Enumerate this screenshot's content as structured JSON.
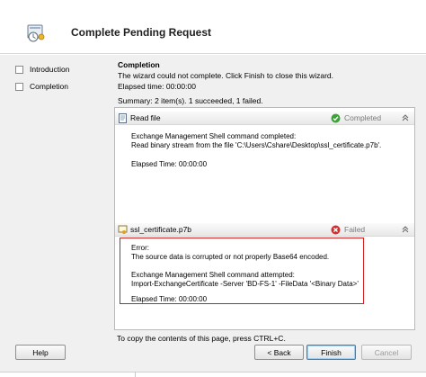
{
  "header": {
    "title": "Complete Pending Request"
  },
  "nav": {
    "items": [
      {
        "label": "Introduction"
      },
      {
        "label": "Completion"
      }
    ]
  },
  "completion": {
    "title": "Completion",
    "status": "The wizard could not complete. Click Finish to close this wizard.",
    "elapsed": "Elapsed time: 00:00:00",
    "summary": "Summary: 2 item(s). 1 succeeded, 1 failed."
  },
  "steps": [
    {
      "name": "Read file",
      "status": "Completed",
      "status_color": "#3aa335",
      "lines": [
        "Exchange Management Shell command completed:",
        "Read binary stream from the file 'C:\\Users\\Cshare\\Desktop\\ssl_certificate.p7b'.",
        "Elapsed Time: 00:00:00"
      ]
    },
    {
      "name": "ssl_certificate.p7b",
      "status": "Failed",
      "status_color": "#d32f2f",
      "lines": [
        "Error:",
        "The source data is corrupted or not properly Base64 encoded.",
        "Exchange Management Shell command attempted:",
        "Import-ExchangeCertificate -Server 'BD-FS-1' -FileData '<Binary Data>'",
        "Elapsed Time: 00:00:00"
      ]
    }
  ],
  "footer": {
    "hint": "To copy the contents of this page, press CTRL+C.",
    "help": "Help",
    "back": "< Back",
    "finish": "Finish",
    "cancel": "Cancel"
  }
}
